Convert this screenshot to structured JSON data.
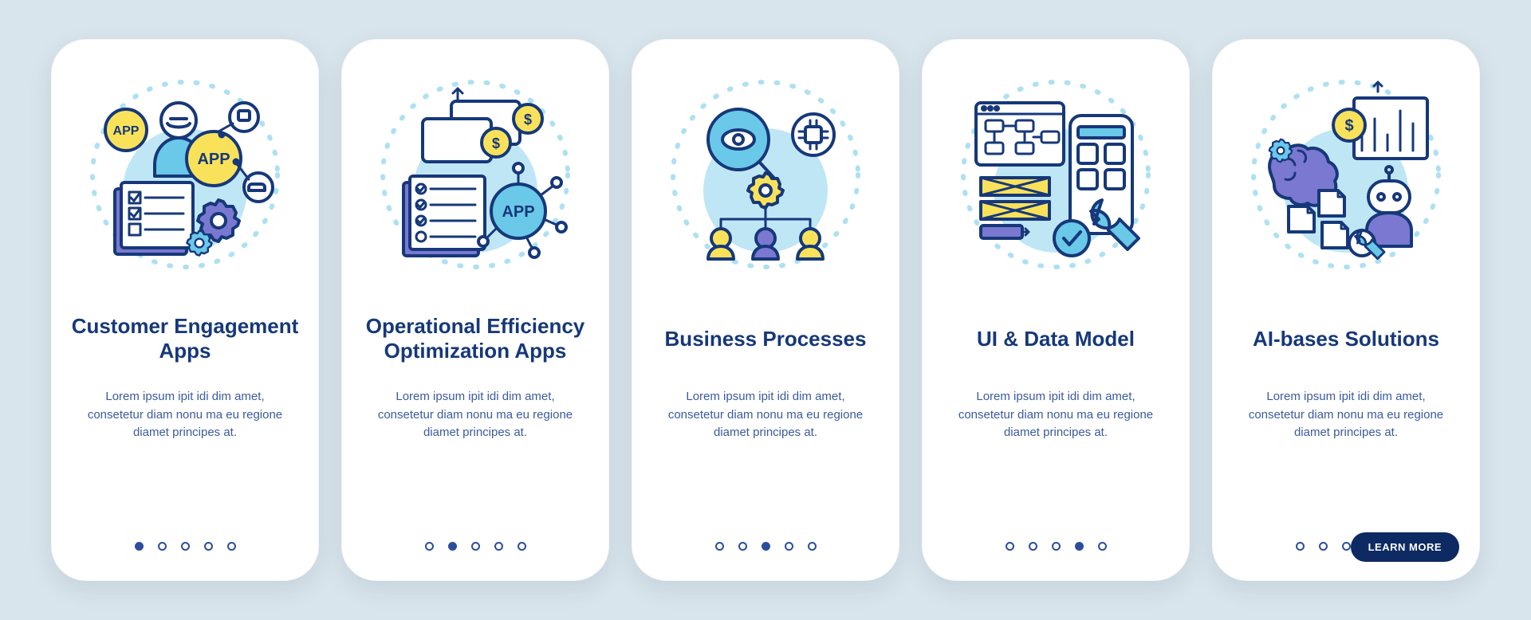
{
  "description": "Lorem ipsum ipit idi dim amet, consetetur diam nonu ma eu regione diamet principes at.",
  "cta_label": "LEARN MORE",
  "total_slides": 5,
  "cards": [
    {
      "title": "Customer Engagement Apps",
      "active_index": 0,
      "icon": "customer-engagement",
      "show_cta": false
    },
    {
      "title": "Operational Efficiency Optimization Apps",
      "active_index": 1,
      "icon": "operational-efficiency",
      "show_cta": false
    },
    {
      "title": "Business Processes",
      "active_index": 2,
      "icon": "business-processes",
      "show_cta": false
    },
    {
      "title": "UI & Data Model",
      "active_index": 3,
      "icon": "ui-data-model",
      "show_cta": false
    },
    {
      "title": "AI-bases Solutions",
      "active_index": 4,
      "icon": "ai-solutions",
      "show_cta": true
    }
  ]
}
